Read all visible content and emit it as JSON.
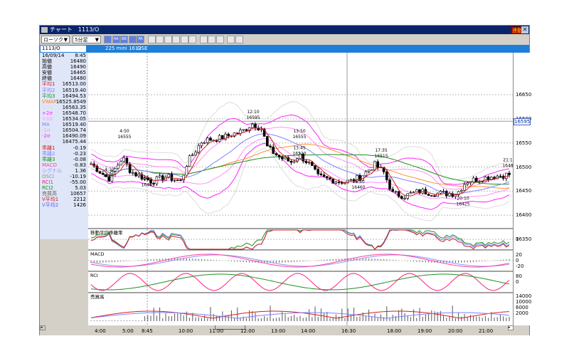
{
  "window": {
    "title": "チャート　1113/O",
    "link_badge": "連動",
    "close_icon": "close-icon"
  },
  "toolbar": {
    "chart_type": "ローソク",
    "interval": "5分足",
    "icons": [
      "bar-chart-icon",
      "ha-icon",
      "bb-icon",
      "rsi-icon",
      "pa-icon",
      "line-icon",
      "candle-icon",
      "zoom-range-icon",
      "magnify-icon",
      "grid-icon",
      "crosshair-icon",
      "pen-icon",
      "pointer-icon",
      "eraser-icon",
      "search-icon",
      "settings-icon"
    ],
    "icon_labels": [
      "",
      "HA",
      "BB",
      "",
      "PA"
    ]
  },
  "infobar": {
    "code": "1113/O",
    "contract": "225 mini 1612",
    "exchange": "OSE"
  },
  "left_panel": {
    "date": "16/09/14",
    "time": "8:45",
    "rows": [
      {
        "label": "始値",
        "value": "16480",
        "color": "#000000"
      },
      {
        "label": "高値",
        "value": "16490",
        "color": "#000000"
      },
      {
        "label": "安値",
        "value": "16465",
        "color": "#000000"
      },
      {
        "label": "終値",
        "value": "16480",
        "color": "#000000"
      },
      {
        "label": "平均1",
        "value": "16513.00",
        "color": "#d02020"
      },
      {
        "label": "平均2",
        "value": "16519.40",
        "color": "#8080ff"
      },
      {
        "label": "平均3",
        "value": "16494.53",
        "color": "#209020"
      },
      {
        "label": "VWAP",
        "value": "16525.8549",
        "color": "#ff8020"
      },
      {
        "label": "+3σ",
        "value": "16563.35",
        "color": "#e8d0f0"
      },
      {
        "label": "+2σ",
        "value": "16548.70",
        "color": "#ff20ff"
      },
      {
        "label": "+1σ",
        "value": "16534.05",
        "color": "#ff90ff"
      },
      {
        "label": "MA",
        "value": "16519.40",
        "color": "#8080ff"
      },
      {
        "label": "-1σ",
        "value": "16504.74",
        "color": "#ff90ff"
      },
      {
        "label": "-2σ",
        "value": "16490.09",
        "color": "#ff20ff"
      },
      {
        "label": "-3σ",
        "value": "16475.44",
        "color": "#e8d0f0"
      },
      {
        "label": "乖離1",
        "value": "-0.19",
        "color": "#d02020"
      },
      {
        "label": "乖離2",
        "value": "-0.23",
        "color": "#8080ff"
      },
      {
        "label": "乖離3",
        "value": "-0.08",
        "color": "#209020"
      },
      {
        "label": "MACD",
        "value": "-0.83",
        "color": "#ff40a0"
      },
      {
        "label": "シグナル",
        "value": "1.36",
        "color": "#9090ff"
      },
      {
        "label": "OSCI",
        "value": "-10.19",
        "color": "#909090"
      },
      {
        "label": "RCI1",
        "value": "-55.00",
        "color": "#ff2080"
      },
      {
        "label": "RCI2",
        "value": "5.03",
        "color": "#209020"
      },
      {
        "label": "売買高",
        "value": "10657",
        "color": "#606060"
      },
      {
        "label": "V平均1",
        "value": "2212",
        "color": "#d02020"
      },
      {
        "label": "V平均2",
        "value": "1426",
        "color": "#6060ff"
      }
    ]
  },
  "main_chart": {
    "price_ticks": [
      "16650",
      "16600",
      "16550",
      "16500",
      "16450",
      "16400",
      "16350"
    ],
    "current_price": "16595",
    "annotations": [
      {
        "time": "4:10",
        "price": "16480"
      },
      {
        "time": "4:50",
        "price": "16555"
      },
      {
        "time": "8:45",
        "price": "16465"
      },
      {
        "time": "12:10",
        "price": "16595"
      },
      {
        "time": "13:50",
        "price": "16555"
      },
      {
        "time": "13:45",
        "price": "16520"
      },
      {
        "time": "16:50",
        "price": "16460"
      },
      {
        "time": "17:35",
        "price": "16515"
      },
      {
        "time": "20:10",
        "price": "16425"
      },
      {
        "time": "21:1",
        "price": "1648"
      }
    ],
    "path": [
      [
        4.0,
        16490
      ],
      [
        4.3,
        16475
      ],
      [
        4.8,
        16520
      ],
      [
        5.0,
        16500
      ],
      [
        5.6,
        16490
      ],
      [
        8.9,
        16470
      ],
      [
        9.4,
        16480
      ],
      [
        9.9,
        16470
      ],
      [
        10.1,
        16510
      ],
      [
        10.6,
        16555
      ],
      [
        11.2,
        16560
      ],
      [
        11.9,
        16575
      ],
      [
        12.2,
        16590
      ],
      [
        12.5,
        16580
      ],
      [
        12.7,
        16540
      ],
      [
        13.1,
        16520
      ],
      [
        13.5,
        16510
      ],
      [
        13.75,
        16525
      ],
      [
        14.2,
        16505
      ],
      [
        14.7,
        16480
      ],
      [
        16.0,
        16470
      ],
      [
        16.6,
        16470
      ],
      [
        16.95,
        16480
      ],
      [
        17.4,
        16505
      ],
      [
        17.7,
        16490
      ],
      [
        18.0,
        16445
      ],
      [
        18.4,
        16440
      ],
      [
        18.9,
        16450
      ],
      [
        19.4,
        16445
      ],
      [
        20.1,
        16445
      ],
      [
        20.4,
        16470
      ],
      [
        21.2,
        16480
      ],
      [
        21.9,
        16485
      ]
    ],
    "colors": {
      "ma1": "#d02020",
      "ma2": "#8080ff",
      "ma3": "#209020",
      "vwap": "#ff9030",
      "bb2": "#ff20ff",
      "bb1": "#ff90ff",
      "bb3": "#dcdcdc"
    }
  },
  "sub_panels": [
    {
      "title": "移動平均乖離率",
      "ticks": [
        "0"
      ]
    },
    {
      "title": "MACD",
      "ticks": [
        "20",
        "0",
        "-20"
      ]
    },
    {
      "title": "RCI",
      "ticks": [
        "80",
        "0"
      ]
    },
    {
      "title": "売買高",
      "ticks": [
        "14000",
        "10000",
        "6000",
        "2000"
      ]
    }
  ],
  "time_axis": [
    "4:00",
    "5:00",
    "8:45",
    "10:00",
    "11:00",
    "12:00",
    "13:00",
    "14:00",
    "16:30",
    "18:00",
    "19:00",
    "20:00",
    "21:00"
  ]
}
